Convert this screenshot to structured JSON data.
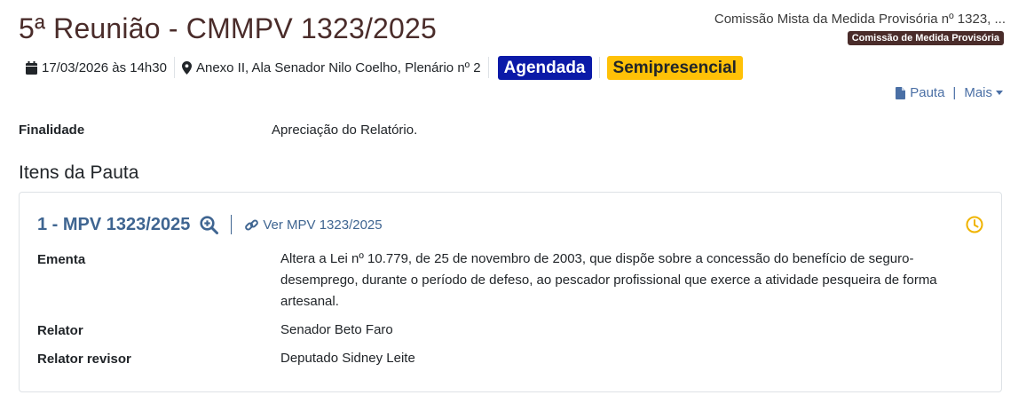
{
  "meeting": {
    "title": "5ª Reunião - CMMPV 1323/2025",
    "committee_name": "Comissão Mista da Medida Provisória nº 1323, ...",
    "committee_type": "Comissão de Medida Provisória",
    "datetime": "17/03/2026 às 14h30",
    "location": "Anexo II, Ala Senador Nilo Coelho, Plenário nº 2",
    "status_badge": "Agendada",
    "mode_badge": "Semipresencial"
  },
  "actions": {
    "pauta_label": "Pauta",
    "separator": "|",
    "more_label": "Mais"
  },
  "purpose": {
    "label": "Finalidade",
    "value": "Apreciação do Relatório."
  },
  "agenda": {
    "section_title": "Itens da Pauta",
    "items": [
      {
        "title": "1 - MPV 1323/2025",
        "link_label": "Ver MPV 1323/2025",
        "ementa_label": "Ementa",
        "ementa": "Altera a Lei nº 10.779, de 25 de novembro de 2003, que dispõe sobre a concessão do benefício de seguro-desemprego, durante o período de defeso, ao pescador profissional que exerce a atividade pesqueira de forma artesanal.",
        "relator_label": "Relator",
        "relator": "Senador Beto Faro",
        "relator_revisor_label": "Relator revisor",
        "relator_revisor": "Deputado Sidney Leite"
      }
    ]
  },
  "colors": {
    "title_brown": "#4a2c2a",
    "badge_blue": "#0b1aa8",
    "badge_yellow": "#ffc107",
    "link_blue": "#3f6591",
    "clock_yellow": "#f0b400"
  },
  "icons": [
    "calendar-icon",
    "map-marker-icon",
    "file-icon",
    "caret-down-icon",
    "zoom-in-icon",
    "link-icon",
    "clock-icon"
  ]
}
